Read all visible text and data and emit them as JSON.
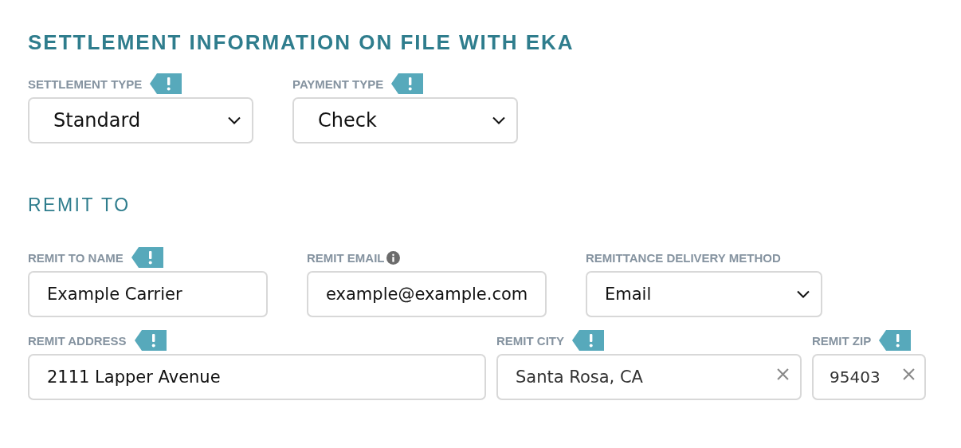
{
  "sections": [
    {
      "title": "SETTLEMENT INFORMATION ON FILE WITH EKA",
      "major": true,
      "rows": [
        {
          "fields": [
            {
              "label": "SETTLEMENT TYPE",
              "kind": "select",
              "value": "Standard",
              "required": true,
              "info": false,
              "clearable": false
            },
            {
              "label": "PAYMENT TYPE",
              "kind": "select",
              "value": "Check",
              "required": true,
              "info": false,
              "clearable": false
            }
          ]
        }
      ]
    },
    {
      "title": "REMIT TO",
      "major": false,
      "rows": [
        {
          "fields": [
            {
              "label": "REMIT TO NAME",
              "kind": "text",
              "value": "Example Carrier",
              "required": true,
              "info": false,
              "clearable": false
            },
            {
              "label": "REMIT EMAIL",
              "kind": "text",
              "value": "example@example.com",
              "required": false,
              "info": true,
              "clearable": false
            },
            {
              "label": "REMITTANCE DELIVERY METHOD",
              "kind": "select",
              "value": "Email",
              "required": false,
              "info": false,
              "clearable": false
            }
          ]
        },
        {
          "fields": [
            {
              "label": "REMIT ADDRESS",
              "kind": "text",
              "value": "2111 Lapper Avenue",
              "required": true,
              "info": false,
              "clearable": false
            },
            {
              "label": "REMIT CITY",
              "kind": "text",
              "value": "Santa Rosa, CA",
              "required": true,
              "info": false,
              "clearable": true
            },
            {
              "label": "REMIT ZIP",
              "kind": "text",
              "value": "95403",
              "required": true,
              "info": false,
              "clearable": true
            }
          ]
        }
      ]
    }
  ]
}
